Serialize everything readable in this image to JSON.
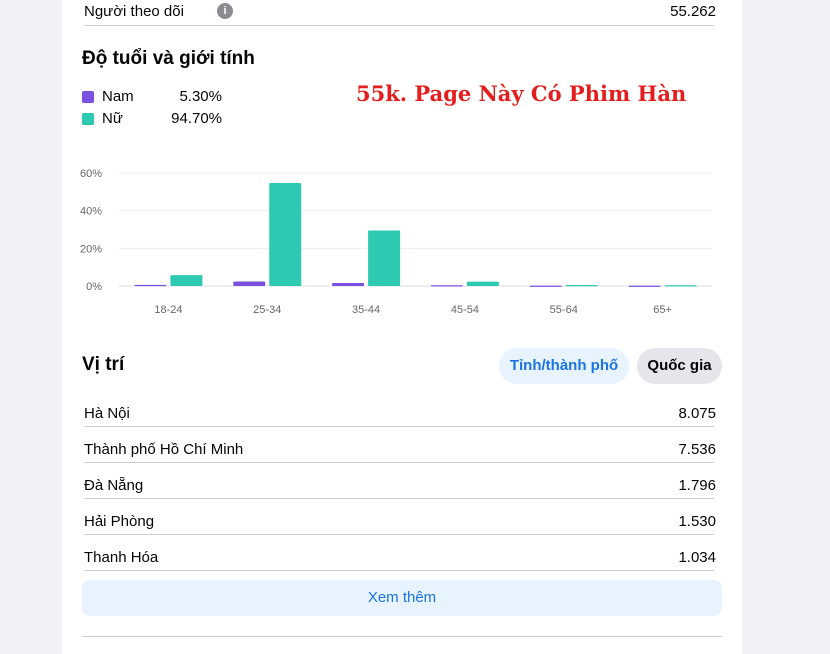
{
  "followers": {
    "label": "Người theo dõi",
    "value": "55.262"
  },
  "demographics": {
    "title": "Độ tuổi và giới tính",
    "legend": [
      {
        "name": "Nam",
        "percent": "5.30%",
        "color": "#7b4fe0"
      },
      {
        "name": "Nữ",
        "percent": "94.70%",
        "color": "#2ec9b1"
      }
    ]
  },
  "overlay_text": "55k. Page Này Có Phim Hàn",
  "chart_data": {
    "type": "bar",
    "categories": [
      "18-24",
      "25-34",
      "35-44",
      "45-54",
      "55-64",
      "65+"
    ],
    "series": [
      {
        "name": "Nam",
        "color": "#7b4fe0",
        "values": [
          0.6,
          2.4,
          1.6,
          0.4,
          0.2,
          0.2
        ]
      },
      {
        "name": "Nữ",
        "color": "#2ec9b1",
        "values": [
          5.8,
          54.7,
          29.5,
          2.3,
          0.5,
          0.4
        ]
      }
    ],
    "yticks": [
      "0%",
      "20%",
      "40%",
      "60%"
    ],
    "ylim": [
      0,
      60
    ],
    "grid": true,
    "title": "",
    "xlabel": "",
    "ylabel": ""
  },
  "location": {
    "title": "Vị trí",
    "tabs": {
      "province": "Tỉnh/thành phố",
      "country": "Quốc gia"
    },
    "rows": [
      {
        "name": "Hà Nội",
        "count": "8.075"
      },
      {
        "name": "Thành phố Hồ Chí Minh",
        "count": "7.536"
      },
      {
        "name": "Đà Nẵng",
        "count": "1.796"
      },
      {
        "name": "Hải Phòng",
        "count": "1.530"
      },
      {
        "name": "Thanh Hóa",
        "count": "1.034"
      }
    ],
    "more_label": "Xem thêm"
  }
}
